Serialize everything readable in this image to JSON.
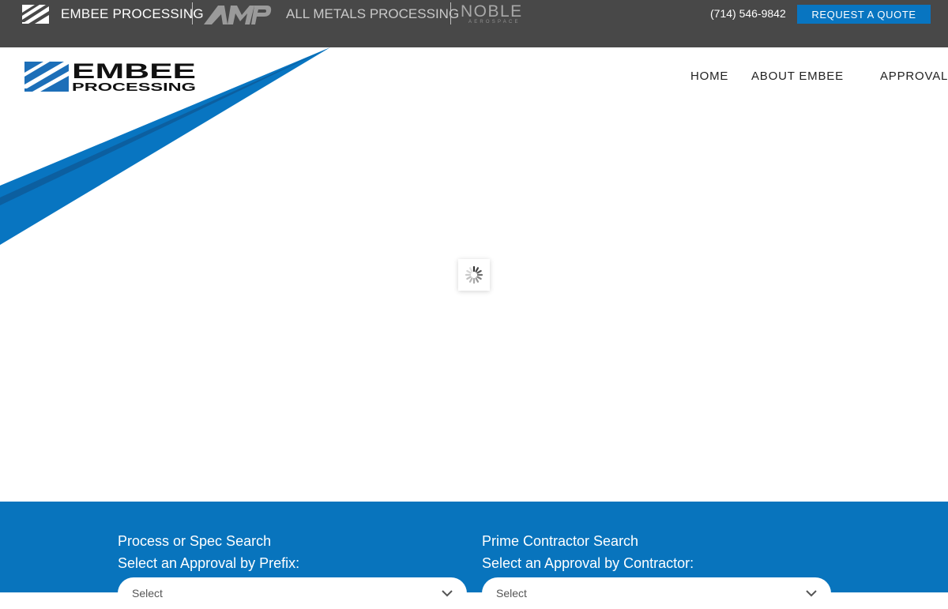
{
  "topbar": {
    "brands": [
      {
        "name": "EMBEE PROCESSING",
        "icon": "embee-mark-icon"
      },
      {
        "name": "ALL METALS PROCESSING",
        "icon": "amp-logo-icon"
      },
      {
        "name_line1": "NOBLE",
        "name_line2": "AEROSPACE"
      }
    ],
    "phone": "(714) 546-9842",
    "quote_label": "REQUEST A QUOTE",
    "background": "#484848",
    "accent": "#0875c1"
  },
  "header": {
    "logo_line1": "EMBEE",
    "logo_line2": "PROCESSING",
    "nav": [
      "HOME",
      "ABOUT EMBEE",
      "APPROVALS"
    ]
  },
  "loader": {
    "icon": "spinner-icon"
  },
  "search": {
    "background": "#0874bd",
    "left": {
      "title": "Process or Spec Search",
      "subtitle": "Select an Approval by Prefix:",
      "select_value": "Select"
    },
    "right": {
      "title": "Prime Contractor Search",
      "subtitle": "Select an Approval by Contractor:",
      "select_value": "Select"
    }
  }
}
